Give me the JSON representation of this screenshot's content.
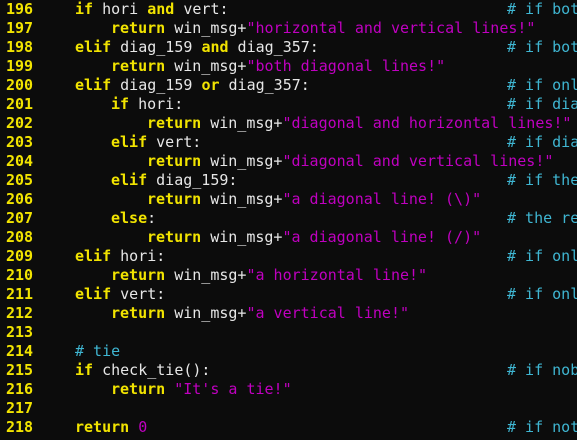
{
  "colors": {
    "background": "#0c0c0c",
    "line_number": "#f2e400",
    "keyword": "#f2e400",
    "identifier": "#e7e7e7",
    "string": "#c000c0",
    "comment": "#3fb6d2"
  },
  "lines": [
    {
      "n": "196",
      "indent": 0,
      "tokens": [
        {
          "t": "if",
          "c": "kw"
        },
        {
          "t": " hori ",
          "c": "id"
        },
        {
          "t": "and",
          "c": "kw"
        },
        {
          "t": " vert:",
          "c": "id"
        }
      ],
      "comment": "# if bot"
    },
    {
      "n": "197",
      "indent": 1,
      "tokens": [
        {
          "t": "return",
          "c": "kw"
        },
        {
          "t": " win_msg+",
          "c": "id"
        },
        {
          "t": "\"horizontal and vertical lines!\"",
          "c": "str"
        }
      ],
      "comment": ""
    },
    {
      "n": "198",
      "indent": 0,
      "tokens": [
        {
          "t": "elif",
          "c": "kw"
        },
        {
          "t": " diag_159 ",
          "c": "id"
        },
        {
          "t": "and",
          "c": "kw"
        },
        {
          "t": " diag_357:",
          "c": "id"
        }
      ],
      "comment": "# if bot"
    },
    {
      "n": "199",
      "indent": 1,
      "tokens": [
        {
          "t": "return",
          "c": "kw"
        },
        {
          "t": " win_msg+",
          "c": "id"
        },
        {
          "t": "\"both diagonal lines!\"",
          "c": "str"
        }
      ],
      "comment": ""
    },
    {
      "n": "200",
      "indent": 0,
      "tokens": [
        {
          "t": "elif",
          "c": "kw"
        },
        {
          "t": " diag_159 ",
          "c": "id"
        },
        {
          "t": "or",
          "c": "kw"
        },
        {
          "t": " diag_357:",
          "c": "id"
        }
      ],
      "comment": "# if onl"
    },
    {
      "n": "201",
      "indent": 1,
      "tokens": [
        {
          "t": "if",
          "c": "kw"
        },
        {
          "t": " hori:",
          "c": "id"
        }
      ],
      "comment": "# if dia"
    },
    {
      "n": "202",
      "indent": 2,
      "tokens": [
        {
          "t": "return",
          "c": "kw"
        },
        {
          "t": " win_msg+",
          "c": "id"
        },
        {
          "t": "\"diagonal and horizontal lines!\"",
          "c": "str"
        }
      ],
      "comment": ""
    },
    {
      "n": "203",
      "indent": 1,
      "tokens": [
        {
          "t": "elif",
          "c": "kw"
        },
        {
          "t": " vert:",
          "c": "id"
        }
      ],
      "comment": "# if dia"
    },
    {
      "n": "204",
      "indent": 2,
      "tokens": [
        {
          "t": "return",
          "c": "kw"
        },
        {
          "t": " win_msg+",
          "c": "id"
        },
        {
          "t": "\"diagonal and vertical lines!\"",
          "c": "str"
        }
      ],
      "comment": ""
    },
    {
      "n": "205",
      "indent": 1,
      "tokens": [
        {
          "t": "elif",
          "c": "kw"
        },
        {
          "t": " diag_159:",
          "c": "id"
        }
      ],
      "comment": "# if the"
    },
    {
      "n": "206",
      "indent": 2,
      "tokens": [
        {
          "t": "return",
          "c": "kw"
        },
        {
          "t": " win_msg+",
          "c": "id"
        },
        {
          "t": "\"a diagonal line! (\\)\"",
          "c": "str"
        }
      ],
      "comment": ""
    },
    {
      "n": "207",
      "indent": 1,
      "tokens": [
        {
          "t": "else",
          "c": "kw"
        },
        {
          "t": ":",
          "c": "id"
        }
      ],
      "comment": "# the re"
    },
    {
      "n": "208",
      "indent": 2,
      "tokens": [
        {
          "t": "return",
          "c": "kw"
        },
        {
          "t": " win_msg+",
          "c": "id"
        },
        {
          "t": "\"a diagonal line! (/)\"",
          "c": "str"
        }
      ],
      "comment": ""
    },
    {
      "n": "209",
      "indent": 0,
      "tokens": [
        {
          "t": "elif",
          "c": "kw"
        },
        {
          "t": " hori:",
          "c": "id"
        }
      ],
      "comment": "# if onl"
    },
    {
      "n": "210",
      "indent": 1,
      "tokens": [
        {
          "t": "return",
          "c": "kw"
        },
        {
          "t": " win_msg+",
          "c": "id"
        },
        {
          "t": "\"a horizontal line!\"",
          "c": "str"
        }
      ],
      "comment": ""
    },
    {
      "n": "211",
      "indent": 0,
      "tokens": [
        {
          "t": "elif",
          "c": "kw"
        },
        {
          "t": " vert:",
          "c": "id"
        }
      ],
      "comment": "# if onl"
    },
    {
      "n": "212",
      "indent": 1,
      "tokens": [
        {
          "t": "return",
          "c": "kw"
        },
        {
          "t": " win_msg+",
          "c": "id"
        },
        {
          "t": "\"a vertical line!\"",
          "c": "str"
        }
      ],
      "comment": ""
    },
    {
      "n": "213",
      "indent": 0,
      "tokens": [],
      "comment": ""
    },
    {
      "n": "214",
      "indent": 0,
      "tokens": [
        {
          "t": "# tie",
          "c": "comment"
        }
      ],
      "comment": ""
    },
    {
      "n": "215",
      "indent": 0,
      "tokens": [
        {
          "t": "if",
          "c": "kw"
        },
        {
          "t": " check_tie():",
          "c": "id"
        }
      ],
      "comment": "# if nob"
    },
    {
      "n": "216",
      "indent": 1,
      "tokens": [
        {
          "t": "return",
          "c": "kw"
        },
        {
          "t": " ",
          "c": "id"
        },
        {
          "t": "\"It's a tie!\"",
          "c": "str"
        }
      ],
      "comment": ""
    },
    {
      "n": "217",
      "indent": 0,
      "tokens": [],
      "comment": ""
    },
    {
      "n": "218",
      "indent": 0,
      "tokens": [
        {
          "t": "return",
          "c": "kw"
        },
        {
          "t": " ",
          "c": "id"
        },
        {
          "t": "0",
          "c": "num"
        }
      ],
      "comment": "# if not"
    }
  ]
}
